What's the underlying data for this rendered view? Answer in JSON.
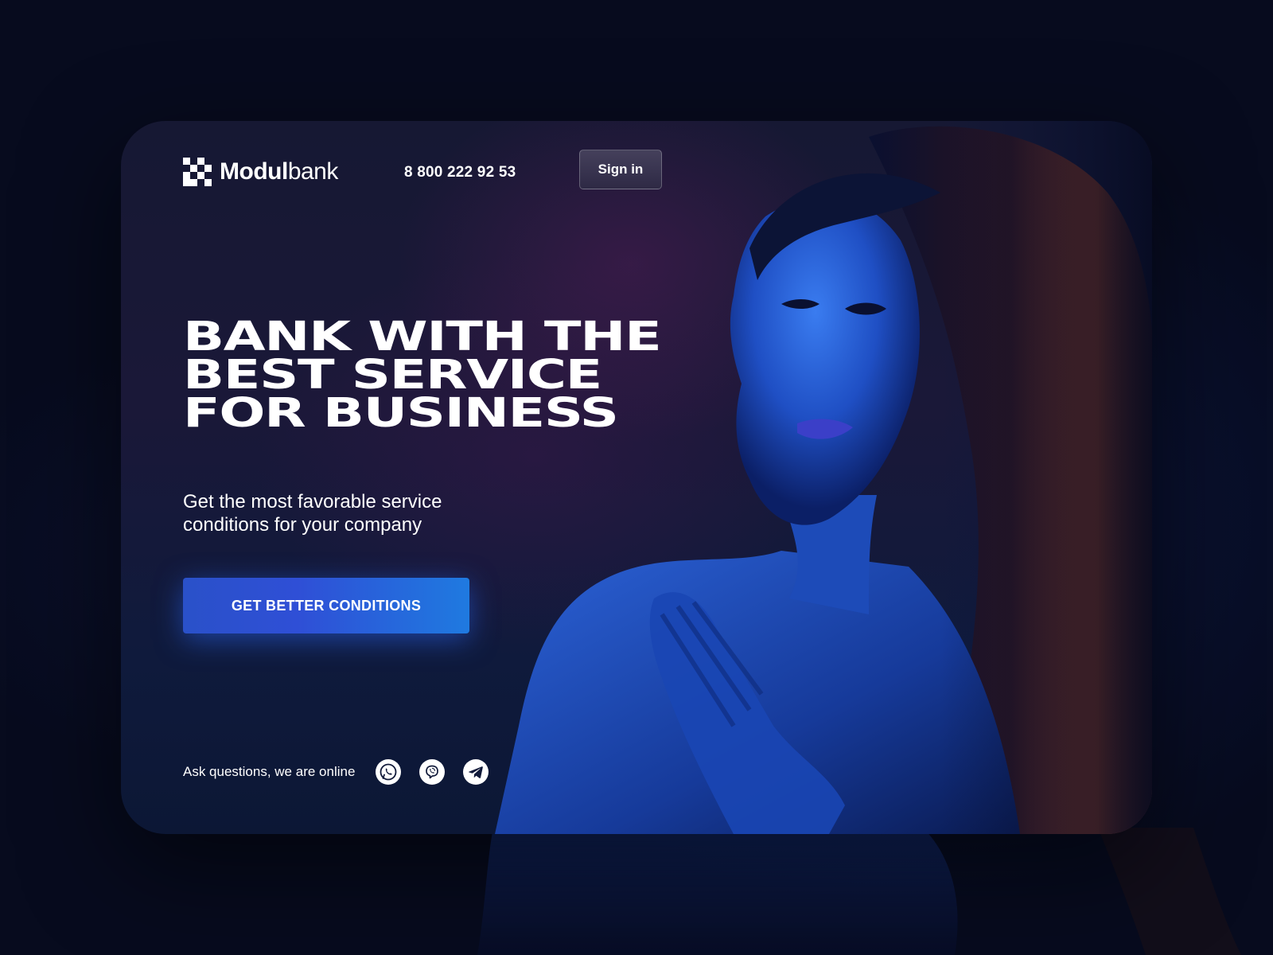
{
  "brand": {
    "name_bold": "Modul",
    "name_light": "bank"
  },
  "header": {
    "phone": "8 800 222 92 53",
    "signin_label": "Sign in"
  },
  "hero": {
    "headline_lines": [
      "BANK WITH THE",
      "BEST SERVICE",
      "FOR BUSINESS"
    ],
    "subtitle_line1": "Get the most favorable service",
    "subtitle_line2": "conditions for your company",
    "cta_label": "GET BETTER CONDITIONS"
  },
  "contact": {
    "label": "Ask questions, we are online",
    "channels": [
      "whatsapp-icon",
      "viber-icon",
      "telegram-icon"
    ]
  },
  "colors": {
    "page_bg": "#070b1e",
    "card_bg": "#161833",
    "cta": "#2a51c9",
    "cta_end": "#1f7ae0",
    "text": "#ffffff"
  }
}
